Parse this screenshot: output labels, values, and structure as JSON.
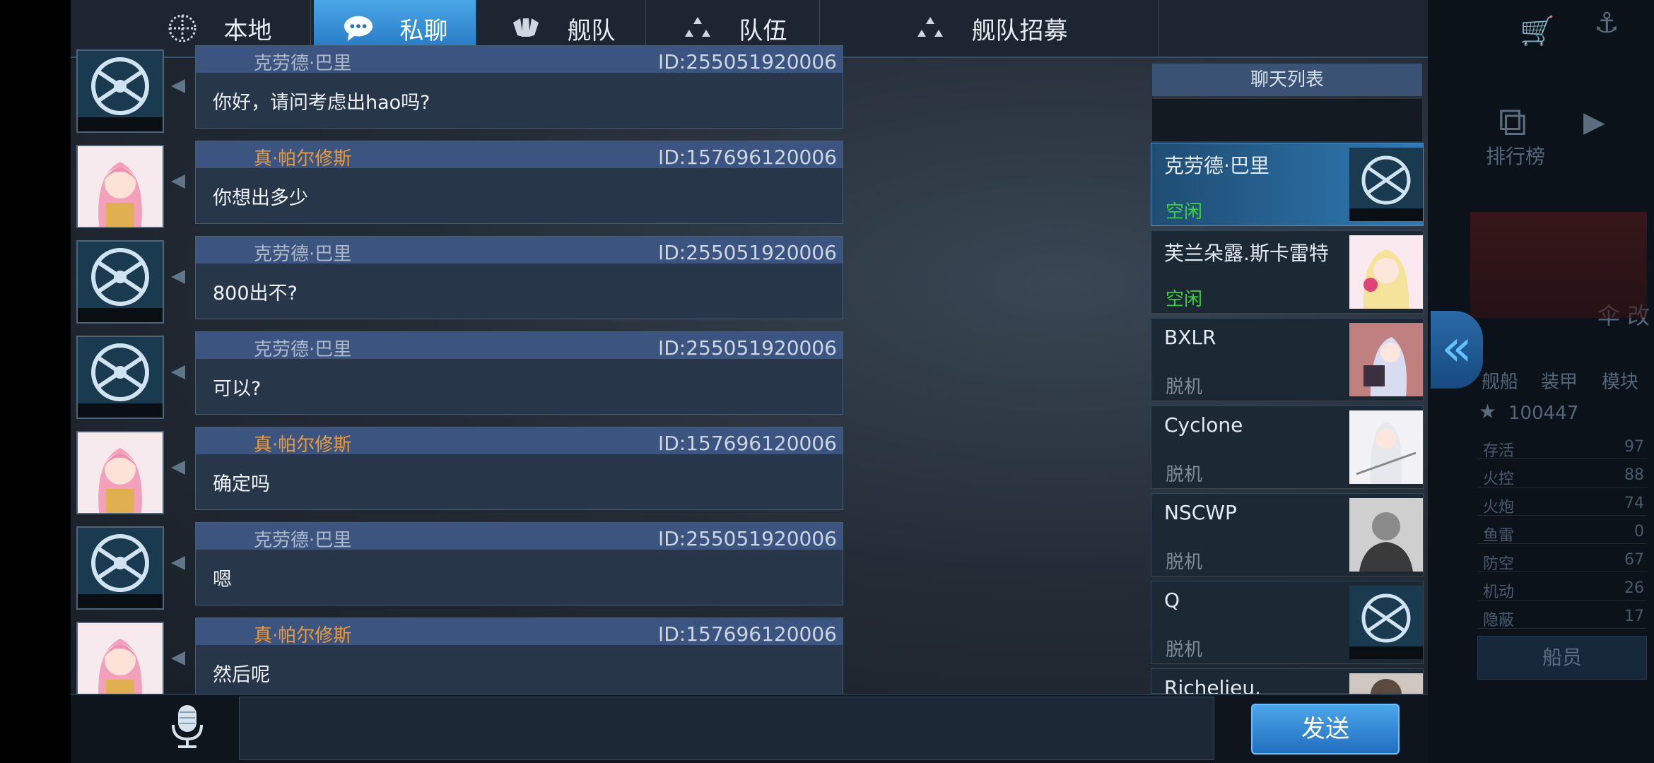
{
  "tabs": [
    {
      "label": "本地",
      "icon": "globe-icon"
    },
    {
      "label": "私聊",
      "icon": "chat-bubble-icon",
      "active": true
    },
    {
      "label": "舰队",
      "icon": "fleet-icon"
    },
    {
      "label": "队伍",
      "icon": "team-icon"
    },
    {
      "label": "舰队招募",
      "icon": "recruit-icon"
    }
  ],
  "messages": [
    {
      "sender": "克劳德·巴里",
      "id": "ID:255051920006",
      "text": "你好，请问考虑出hao吗?",
      "name_color": "gray",
      "avatar": "emblem"
    },
    {
      "sender": "真·帕尔修斯",
      "id": "ID:157696120006",
      "text": "你想出多少",
      "name_color": "orange",
      "avatar": "anime"
    },
    {
      "sender": "克劳德·巴里",
      "id": "ID:255051920006",
      "text": "800出不?",
      "name_color": "gray",
      "avatar": "emblem"
    },
    {
      "sender": "克劳德·巴里",
      "id": "ID:255051920006",
      "text": "可以?",
      "name_color": "gray",
      "avatar": "emblem"
    },
    {
      "sender": "真·帕尔修斯",
      "id": "ID:157696120006",
      "text": "确定吗",
      "name_color": "orange",
      "avatar": "anime"
    },
    {
      "sender": "克劳德·巴里",
      "id": "ID:255051920006",
      "text": "嗯",
      "name_color": "gray",
      "avatar": "emblem"
    },
    {
      "sender": "真·帕尔修斯",
      "id": "ID:157696120006",
      "text": "然后呢",
      "name_color": "orange",
      "avatar": "anime"
    }
  ],
  "chat_list": {
    "title": "聊天列表",
    "items": [
      {
        "name": "克劳德·巴里",
        "status": "空闲",
        "online": true,
        "active": true
      },
      {
        "name": "芙兰朵露.斯卡雷特",
        "status": "空闲",
        "online": true
      },
      {
        "name": "BXLR",
        "status": "脱机",
        "online": false
      },
      {
        "name": "Cyclone",
        "status": "脱机",
        "online": false
      },
      {
        "name": "NSCWP",
        "status": "脱机",
        "online": false
      },
      {
        "name": "Q",
        "status": "脱机",
        "online": false
      },
      {
        "name": "Richelieu.",
        "status": "",
        "online": false
      }
    ]
  },
  "input": {
    "value": "",
    "placeholder": ""
  },
  "send_label": "发送",
  "background_panel": {
    "rank_label": "排行榜",
    "ship_label": "舰船",
    "armor_label": "装甲",
    "module_label": "模块",
    "score": "100447",
    "stats": [
      {
        "k": "存活",
        "v": "97"
      },
      {
        "k": "火控",
        "v": "88"
      },
      {
        "k": "火炮",
        "v": "74"
      },
      {
        "k": "鱼雷",
        "v": "0"
      },
      {
        "k": "防空",
        "v": "67"
      },
      {
        "k": "机动",
        "v": "26"
      },
      {
        "k": "隐蔽",
        "v": "17"
      }
    ],
    "crew_label": "船员",
    "side_text": "伞 改"
  },
  "colors": {
    "accent": "#2f8ad8",
    "online_status": "#3ad23a",
    "orange_name": "#ea9a3a"
  }
}
